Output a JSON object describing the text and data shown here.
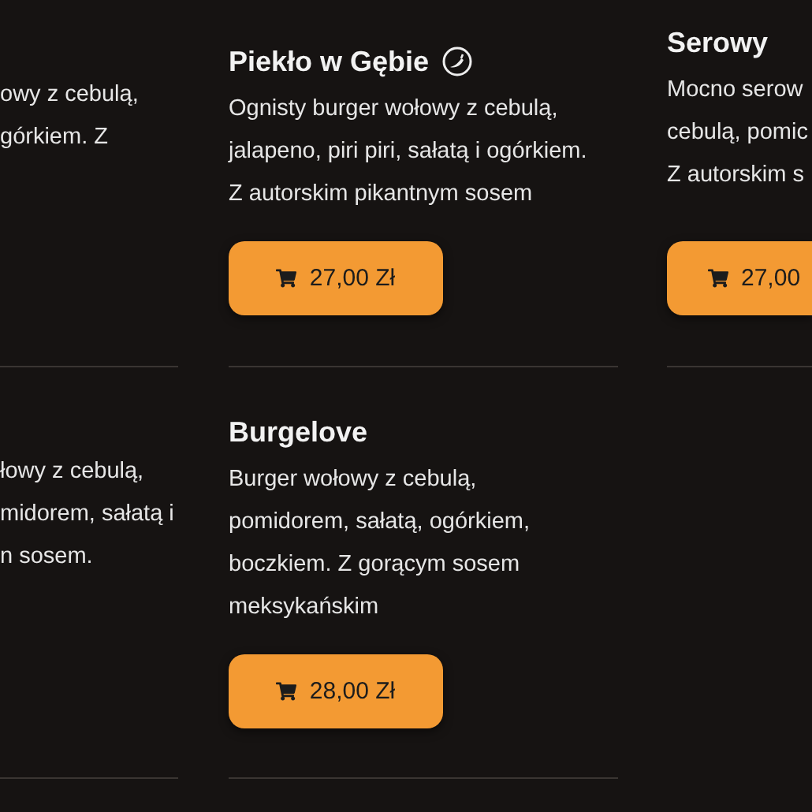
{
  "left_partial_items": [
    {
      "description_lines": [
        "owy z cebulą,",
        "górkiem. Z"
      ]
    },
    {
      "description_lines": [
        "łowy z cebulą,",
        "midorem, sałatą i",
        "n sosem."
      ]
    }
  ],
  "menu_items": [
    {
      "name": "Piekło w Gębie",
      "spicy": true,
      "description": "Ognisty burger wołowy z cebulą, jalapeno, piri piri, sałatą i ogórkiem. Z autorskim pikantnym sosem",
      "price": "27,00 Zł"
    },
    {
      "name": "Burgelove",
      "spicy": false,
      "description": "Burger wołowy z cebulą, pomidorem, sałatą, ogórkiem, boczkiem. Z gorącym sosem meksykańskim",
      "price": "28,00 Zł"
    }
  ],
  "right_partial_items": [
    {
      "name": "Serowy",
      "description_lines": [
        "Mocno serow",
        "cebulą, pomic",
        "Z autorskim s"
      ],
      "price": "27,00"
    }
  ]
}
